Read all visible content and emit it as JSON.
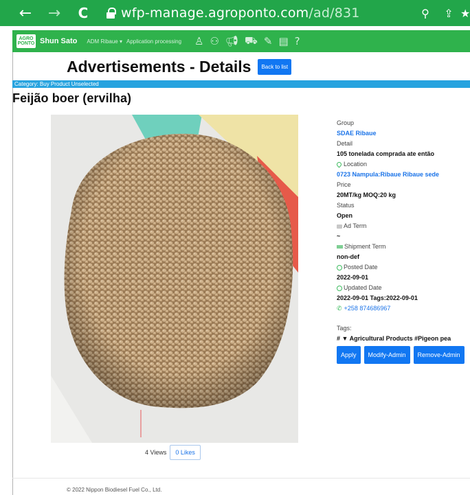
{
  "browser": {
    "url_host": "wfp-manage.agroponto.com",
    "url_path": "/ad/831",
    "back_icon": "arrow-left-icon",
    "forward_icon": "arrow-right-icon",
    "reload_icon": "reload-icon",
    "colors": {
      "bar": "#22a64a"
    }
  },
  "navbar": {
    "logo_text": "AGRO PONTO",
    "user": "Shun Sato",
    "menu_1": "ADM Ribaue ▾",
    "menu_2": "Application processing",
    "icons": [
      "user-icon",
      "users-icon",
      "megaphone-icon",
      "truck-icon",
      "edit-icon",
      "document-icon",
      "help-icon"
    ],
    "colors": {
      "bar": "#2fb24c"
    }
  },
  "page": {
    "title": "Advertisements - Details",
    "back_button": "Back to list",
    "category": "Category: Buy Product Unselected",
    "ad_title": "Feijão boer (ervilha)"
  },
  "details": {
    "group_label": "Group",
    "group_value": "SDAE Ribaue",
    "detail_label": "Detail",
    "detail_value": "105 tonelada comprada ate então",
    "location_label": "Location",
    "location_value": "0723 Nampula:Ribaue Ribaue sede",
    "price_label": "Price",
    "price_value": "20MT/kg MOQ:20 kg",
    "status_label": "Status",
    "status_value": "Open",
    "ad_term_label": "Ad Term",
    "ad_term_value": "~",
    "shipment_label": "Shipment Term",
    "shipment_value": "non-def",
    "posted_label": "Posted Date",
    "posted_value": "2022-09-01",
    "updated_label": "Updated Date",
    "updated_value": "2022-09-01 Tags:2022-09-01",
    "phone": "+258 874686967",
    "tags_label": "Tags:",
    "tags_value": "# ▼ Agricultural Products #Pigeon pea",
    "btn_apply": "Apply",
    "btn_modify": "Modify-Admin",
    "btn_remove": "Remove-Admin"
  },
  "stats": {
    "views": "4 Views",
    "likes": "0 Likes"
  },
  "footer": {
    "copyright": "© 2022 Nippon Biodiesel Fuel Co., Ltd."
  }
}
